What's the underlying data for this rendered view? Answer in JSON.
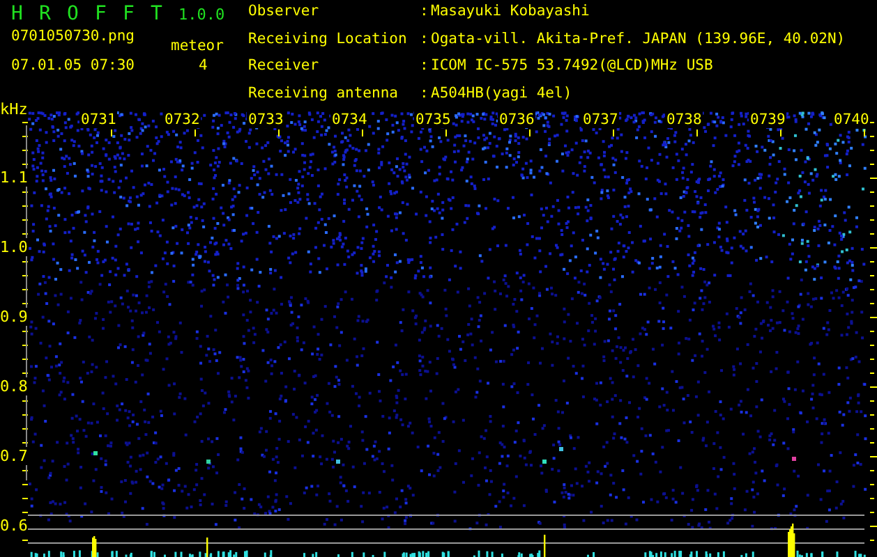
{
  "app": {
    "title_letters": [
      "H",
      "R",
      "O",
      "F",
      "F",
      "T"
    ],
    "version": "1.0.0",
    "file_name": "0701050730.png",
    "meteor_label": "meteor",
    "date_time": "07.01.05 07:30",
    "meteor_count": "4"
  },
  "info": [
    {
      "label": "Observer",
      "separator": ":",
      "value": "Masayuki Kobayashi"
    },
    {
      "label": "Receiving Location",
      "separator": ":",
      "value": "Ogata-vill. Akita-Pref. JAPAN (139.96E, 40.02N)"
    },
    {
      "label": "Receiver",
      "separator": ":",
      "value": "ICOM IC-575 53.7492(@LCD)MHz USB"
    },
    {
      "label": "Receiving antenna",
      "separator": ":",
      "value": "A504HB(yagi 4el)"
    }
  ],
  "spectrogram": {
    "y_unit": "kHz",
    "y_labels": [
      "1.1",
      "1.0",
      "0.9",
      "0.8",
      "0.7",
      "0.6"
    ],
    "time_labels": [
      "0731",
      "0732",
      "0733",
      "0734",
      "0735",
      "0736",
      "0737",
      "0738",
      "0739",
      "0740"
    ]
  }
}
